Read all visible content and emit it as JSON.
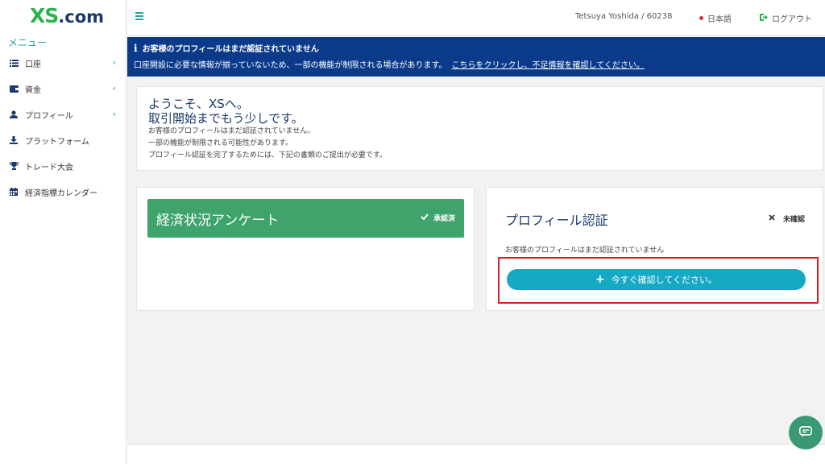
{
  "brand": {
    "logo_main": "XS",
    "logo_suffix": ".com"
  },
  "sidebar": {
    "title": "メニュー",
    "items": [
      {
        "label": "口座",
        "icon": "list-icon",
        "has_chevron": true
      },
      {
        "label": "資金",
        "icon": "wallet-icon",
        "has_chevron": true
      },
      {
        "label": "プロフィール",
        "icon": "user-icon",
        "has_chevron": true
      },
      {
        "label": "プラットフォーム",
        "icon": "download-icon",
        "has_chevron": false
      },
      {
        "label": "トレード大会",
        "icon": "trophy-icon",
        "has_chevron": false
      },
      {
        "label": "経済指標カレンダー",
        "icon": "calendar-icon",
        "has_chevron": false
      }
    ]
  },
  "header": {
    "user": "Tetsuya Yoshida / 60238",
    "language": "日本語",
    "logout": "ログアウト"
  },
  "alert": {
    "title": "お客様のプロフィールはまだ認証されていません",
    "message": "口座開設に必要な情報が揃っていないため、一部の機能が制限される場合があります。",
    "link": "こちらをクリックし、不足情報を確認してください。"
  },
  "welcome": {
    "heading1": "ようこそ、XSへ。",
    "heading2": "取引開始までもう少しです。",
    "line1": "お客様のプロフィールはまだ認証されていません。",
    "line2": "一部の機能が制限される可能性があります。",
    "line3": "プロフィール認証を完了するためには、下記の書類のご提出が必要です。"
  },
  "survey": {
    "title": "経済状況アンケート",
    "status": "承認済"
  },
  "profile": {
    "title": "プロフィール認証",
    "status": "未確認",
    "message": "お客様のプロフィールはまだ認証されていません",
    "button": "今すぐ確認してください。"
  },
  "colors": {
    "brand_green": "#2cb34a",
    "teal": "#2aa199",
    "alert_blue": "#0b3a8a",
    "survey_green": "#3fa36c",
    "button_cyan": "#16a9c4",
    "highlight_red": "#d42020"
  }
}
